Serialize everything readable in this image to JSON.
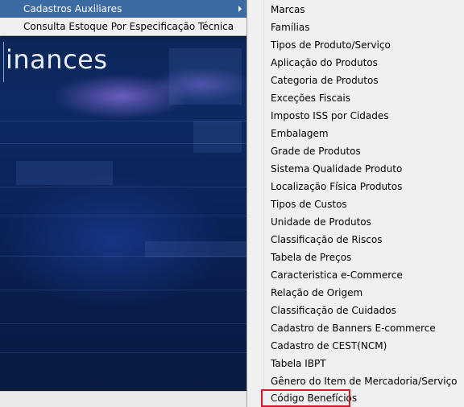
{
  "background": {
    "brand_text": "inances"
  },
  "main_menu": {
    "items": [
      {
        "label": "Cadastros Auxiliares",
        "has_submenu": true,
        "highlighted": true
      },
      {
        "label": "Consulta Estoque Por Especificação Técnica",
        "has_submenu": false,
        "highlighted": false
      }
    ]
  },
  "submenu": {
    "items": [
      "Marcas",
      "Famílias",
      "Tipos de Produto/Serviço",
      "Aplicação do Produtos",
      "Categoria de Produtos",
      "Exceções Fiscais",
      "Imposto ISS por Cidades",
      "Embalagem",
      "Grade de Produtos",
      "Sistema Qualidade Produto",
      "Localização Física Produtos",
      "Tipos de Custos",
      "Unidade de Produtos",
      "Classificação de Riscos",
      "Tabela de Preços",
      "Caracteristica e-Commerce",
      "Relação de Origem",
      "Classificação de Cuidados",
      "Cadastro de Banners E-commerce",
      "Cadastro de CEST(NCM)",
      "Tabela IBPT",
      "Gênero do Item de Mercadoria/Serviço",
      "Código Benefícios"
    ],
    "highlighted_item": "Código Benefícios"
  },
  "colors": {
    "menu_highlight": "#3c6aa3",
    "annotation_box": "#d4182e",
    "menu_background": "#f0f0f0"
  }
}
